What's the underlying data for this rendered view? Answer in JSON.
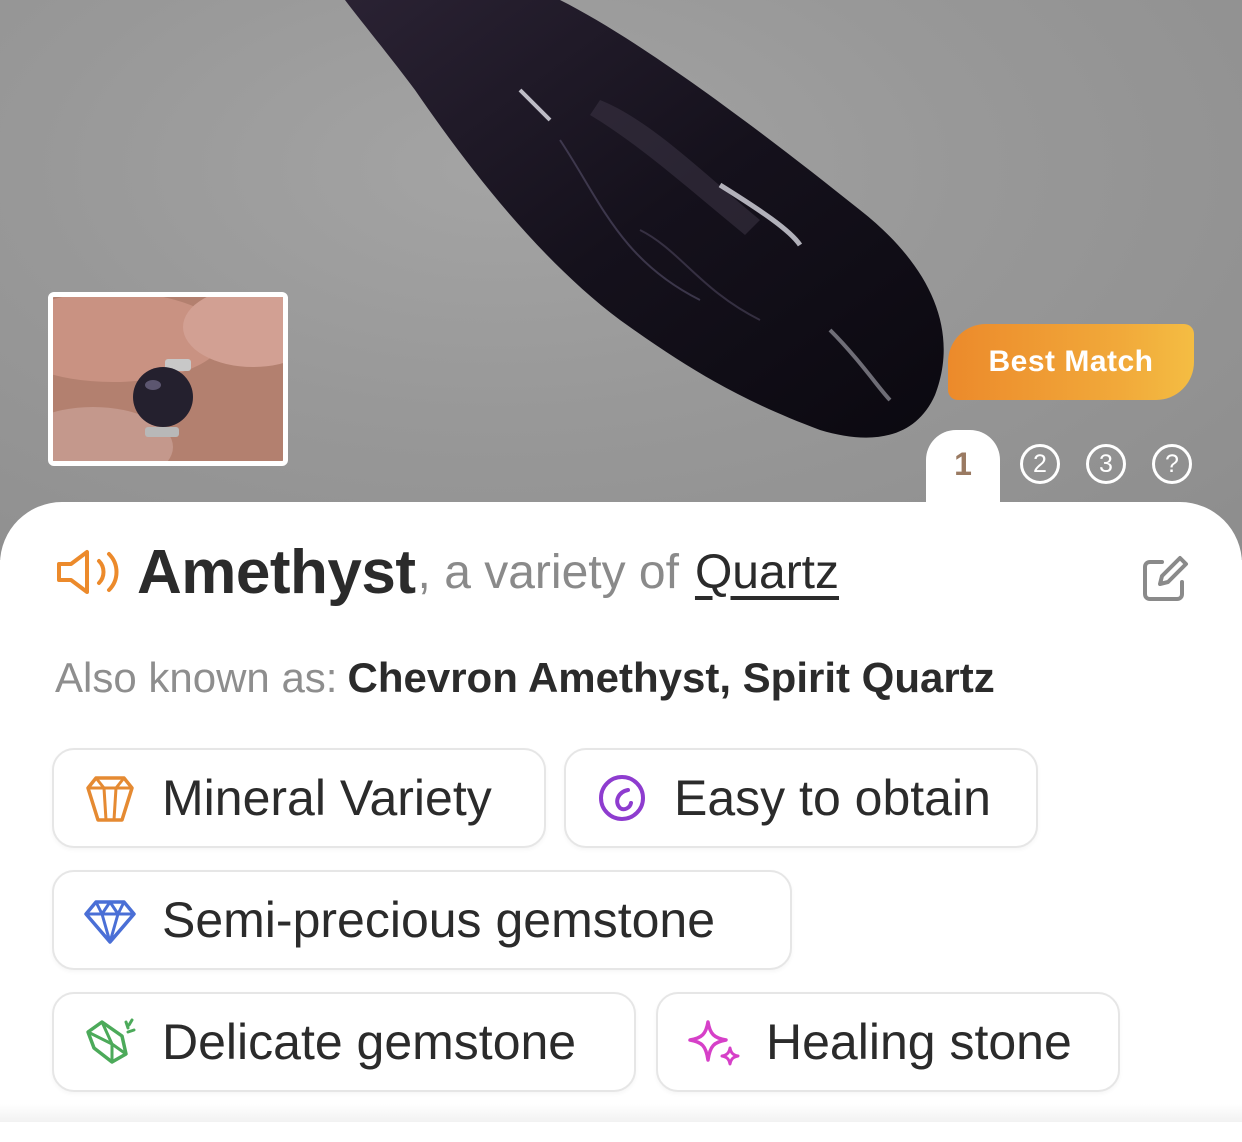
{
  "result": {
    "badge": "Best Match",
    "name": "Amethyst",
    "variety_prefix": ", a variety of",
    "parent": "Quartz",
    "aka_label": "Also known as:",
    "aka_values": "Chevron Amethyst, Spirit Quartz"
  },
  "pager": {
    "tabs": [
      {
        "label": "1",
        "active": true
      },
      {
        "label": "2",
        "active": false
      },
      {
        "label": "3",
        "active": false
      },
      {
        "label": "?",
        "active": false
      }
    ]
  },
  "tags": [
    {
      "label": "Mineral Variety",
      "icon": "crystal-outline-icon",
      "color": "#e58a32"
    },
    {
      "label": "Easy to obtain",
      "icon": "circle-swirl-icon",
      "color": "#8e3ccf"
    },
    {
      "label": "Semi-precious gemstone",
      "icon": "diamond-icon",
      "color": "#4a6fd6"
    },
    {
      "label": "Delicate gemstone",
      "icon": "cracked-gem-icon",
      "color": "#4caa5a"
    },
    {
      "label": "Healing stone",
      "icon": "sparkles-icon",
      "color": "#d640c8"
    }
  ],
  "colors": {
    "accent_orange": "#ec8a2b",
    "text_dark": "#2b2b2b",
    "text_muted": "#8a8a8a"
  }
}
